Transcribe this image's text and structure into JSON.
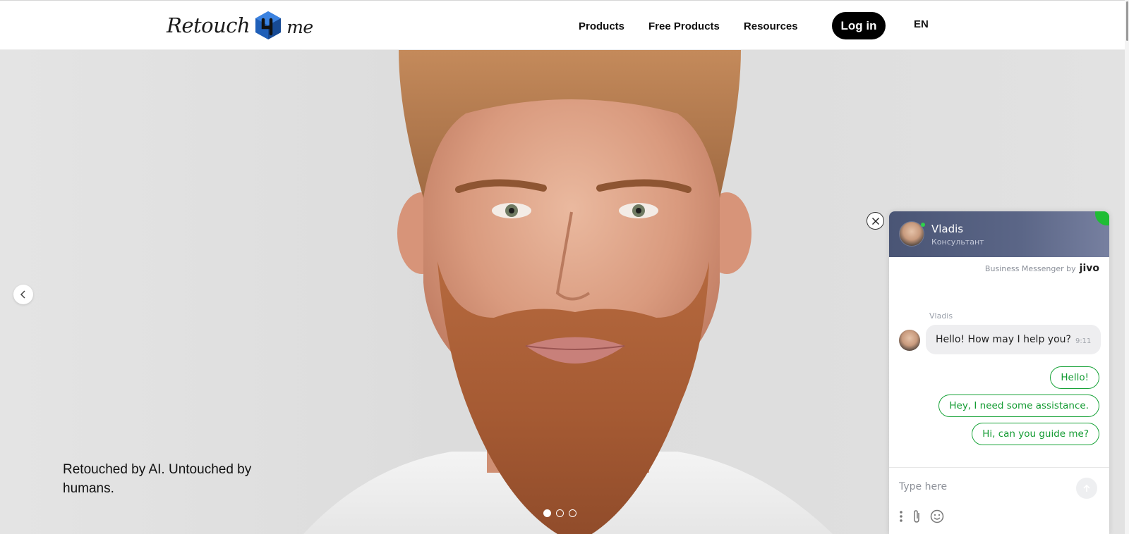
{
  "header": {
    "logo": {
      "part1": "Retouch",
      "part2": "me"
    },
    "nav": [
      "Products",
      "Free Products",
      "Resources"
    ],
    "login_label": "Log in",
    "language": "EN"
  },
  "hero": {
    "caption": "Retouched by AI. Untouched by humans.",
    "slides_total": 3,
    "active_slide": 1
  },
  "chat": {
    "agent_name": "Vladis",
    "agent_role": "Консультант",
    "powered_by": "Business Messenger by",
    "powered_brand": "jivo",
    "message": {
      "author": "Vladis",
      "text": "Hello! How may I help you?",
      "time": "9:11"
    },
    "quick_replies": [
      "Hello!",
      "Hey, I need some assistance.",
      "Hi, can you guide me?"
    ],
    "input_placeholder": "Type here",
    "accent_color": "#1fbd34"
  },
  "icons": {
    "slider_prev": "chevron-left-icon",
    "chat_close": "close-icon",
    "send": "arrow-up-icon",
    "menu": "vertical-dots-icon",
    "attach": "paperclip-icon",
    "emoji": "smiley-icon"
  }
}
